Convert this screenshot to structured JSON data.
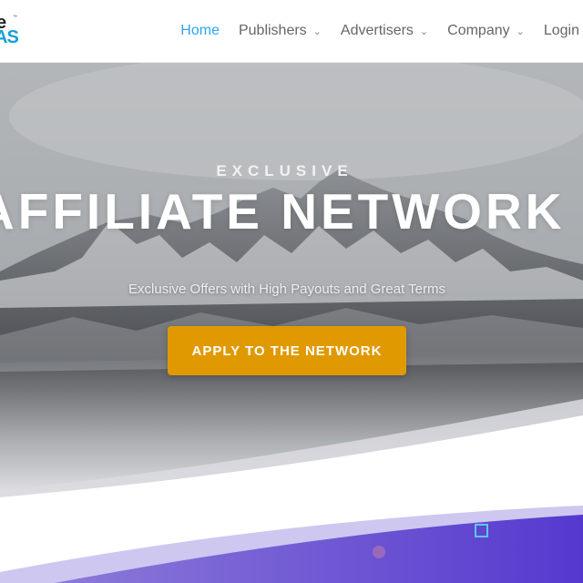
{
  "logo": {
    "line1": "e",
    "line2": "AS",
    "trademark": "™"
  },
  "nav": {
    "items": [
      {
        "label": "Home",
        "active": true,
        "dropdown": false
      },
      {
        "label": "Publishers",
        "active": false,
        "dropdown": true
      },
      {
        "label": "Advertisers",
        "active": false,
        "dropdown": true
      },
      {
        "label": "Company",
        "active": false,
        "dropdown": true
      },
      {
        "label": "Login",
        "active": false,
        "dropdown": false
      }
    ],
    "active_color": "#2ea3f2",
    "chevron_icon": "chevron-down-icon"
  },
  "hero": {
    "eyebrow": "EXCLUSIVE",
    "headline": "AFFILIATE NETWORK",
    "subline": "Exclusive Offers with High Payouts and Great Terms",
    "cta_label": "APPLY TO THE NETWORK",
    "cta_color": "#e09900",
    "wave_color": "#5b3fd0"
  }
}
